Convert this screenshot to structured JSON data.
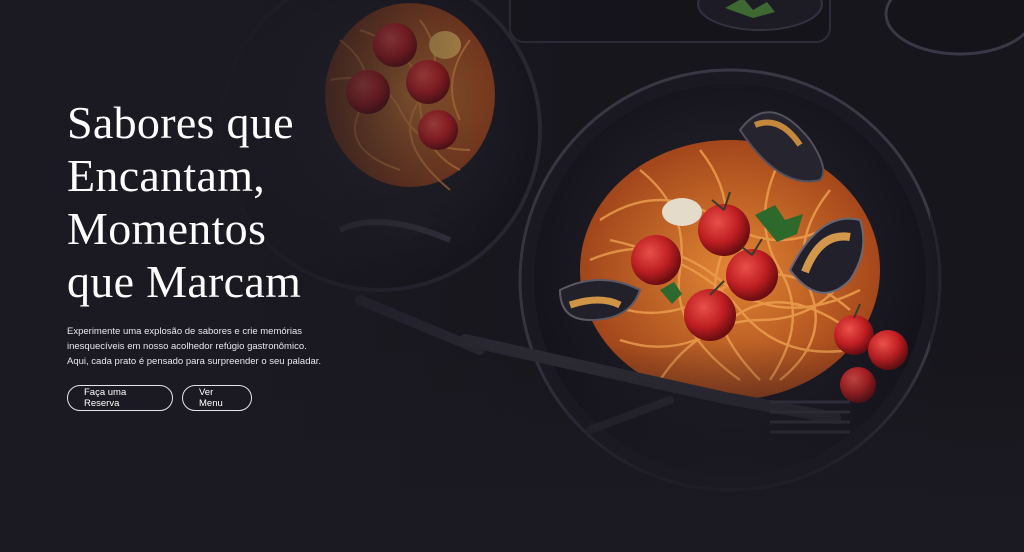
{
  "hero": {
    "title_lines": [
      "Sabores que",
      "Encantam,",
      "Momentos",
      "que Marcam"
    ],
    "description_lines": [
      "Experimente uma explosão de sabores e crie memórias",
      "inesquecíveis em nosso acolhedor refúgio gastronômico.",
      "Aqui, cada prato é pensado para surpreender o seu paladar."
    ],
    "buttons": {
      "reserve_label": "Faça uma Reserva",
      "menu_label": "Ver Menu"
    }
  },
  "colors": {
    "background": "#1b1921",
    "text": "#ffffff",
    "pasta": "#d5722a",
    "tomato": "#c41f22"
  }
}
